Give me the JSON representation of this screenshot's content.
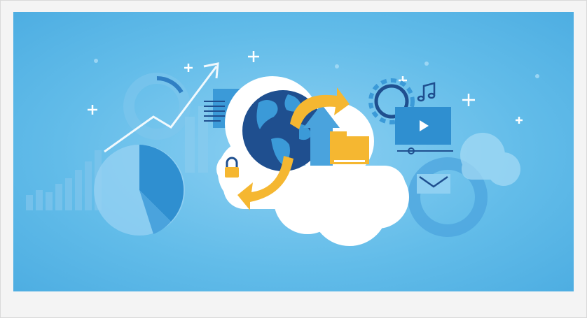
{
  "illustration": {
    "icons": [
      "globe-icon",
      "padlock-icon",
      "sync-arrows-icon",
      "cloud-icon",
      "folder-icon",
      "document-icon",
      "video-player-icon",
      "music-note-icon",
      "envelope-icon",
      "gear-icon",
      "growth-arrow-icon",
      "pie-chart-icon",
      "sparkle-icon"
    ],
    "colors": {
      "background": "#5db9e8",
      "cloud": "#ffffff",
      "globe_ocean": "#1f4f8f",
      "arrow": "#f5b731",
      "folder": "#f5b731",
      "icon_blue": "#2f8fd0"
    }
  }
}
